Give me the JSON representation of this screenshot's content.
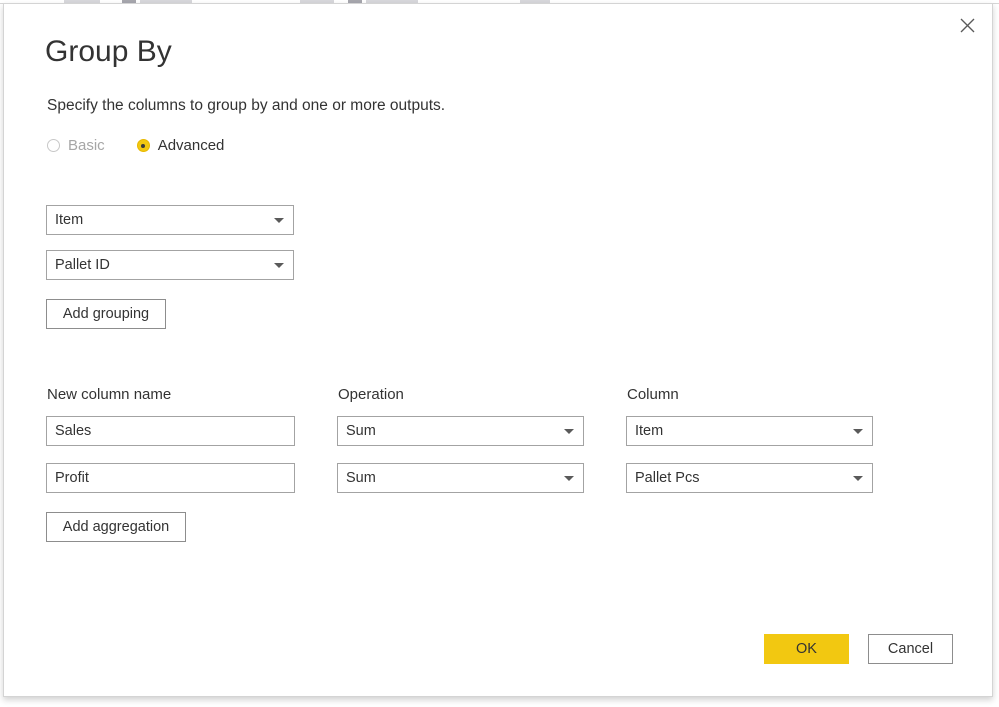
{
  "dialog": {
    "title": "Group By",
    "subtitle": "Specify the columns to group by and one or more outputs.",
    "close_icon": "close-icon"
  },
  "mode": {
    "options": [
      {
        "label": "Basic",
        "selected": false,
        "disabled": true
      },
      {
        "label": "Advanced",
        "selected": true,
        "disabled": false
      }
    ],
    "selected": "Advanced"
  },
  "grouping": {
    "dropdowns": [
      {
        "value": "Item"
      },
      {
        "value": "Pallet ID"
      }
    ],
    "add_button": "Add grouping"
  },
  "aggregation": {
    "headers": {
      "name": "New column name",
      "operation": "Operation",
      "column": "Column"
    },
    "rows": [
      {
        "name": "Sales",
        "operation": "Sum",
        "column": "Item"
      },
      {
        "name": "Profit",
        "operation": "Sum",
        "column": "Pallet Pcs"
      }
    ],
    "add_button": "Add aggregation"
  },
  "footer": {
    "ok": "OK",
    "cancel": "Cancel"
  },
  "colors": {
    "accent": "#F2C811",
    "text": "#333333",
    "border": "#A3A3A3",
    "disabled_text": "#A6A6A6"
  }
}
